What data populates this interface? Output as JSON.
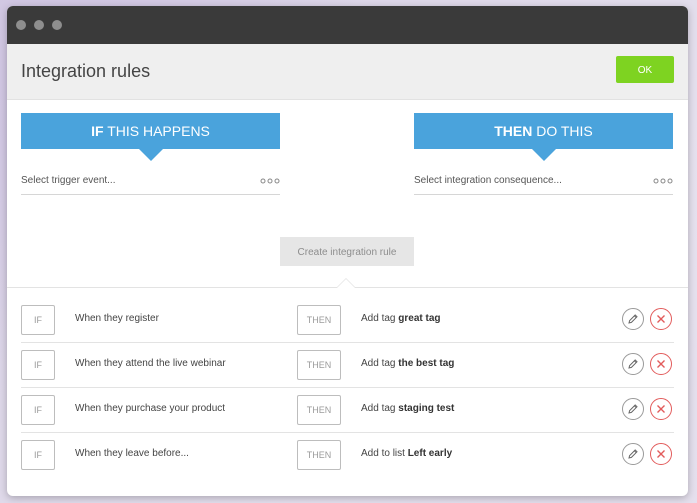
{
  "header": {
    "title": "Integration rules",
    "ok_label": "OK"
  },
  "builder": {
    "if_banner": {
      "keyword": "IF",
      "rest": " THIS HAPPENS"
    },
    "then_banner": {
      "keyword": "THEN",
      "rest": " DO THIS"
    },
    "trigger_placeholder": "Select trigger event...",
    "consequence_placeholder": "Select integration consequence...",
    "create_label": "Create integration rule"
  },
  "rules": [
    {
      "if_label": "IF",
      "trigger": "When they register",
      "then_label": "THEN",
      "action_prefix": "Add tag ",
      "action_value": "great tag"
    },
    {
      "if_label": "IF",
      "trigger": "When they attend the live webinar",
      "then_label": "THEN",
      "action_prefix": "Add tag ",
      "action_value": "the best tag"
    },
    {
      "if_label": "IF",
      "trigger": "When they purchase your product",
      "then_label": "THEN",
      "action_prefix": "Add tag ",
      "action_value": "staging test"
    },
    {
      "if_label": "IF",
      "trigger": "When they leave before...",
      "then_label": "THEN",
      "action_prefix": "Add to list ",
      "action_value": "Left early"
    }
  ],
  "icons": {
    "more": "more-horizontal-icon",
    "edit": "pencil-icon",
    "delete": "close-icon"
  },
  "colors": {
    "accent_blue": "#4aa3dc",
    "ok_green": "#7ed321",
    "delete_red": "#e25b5b"
  }
}
